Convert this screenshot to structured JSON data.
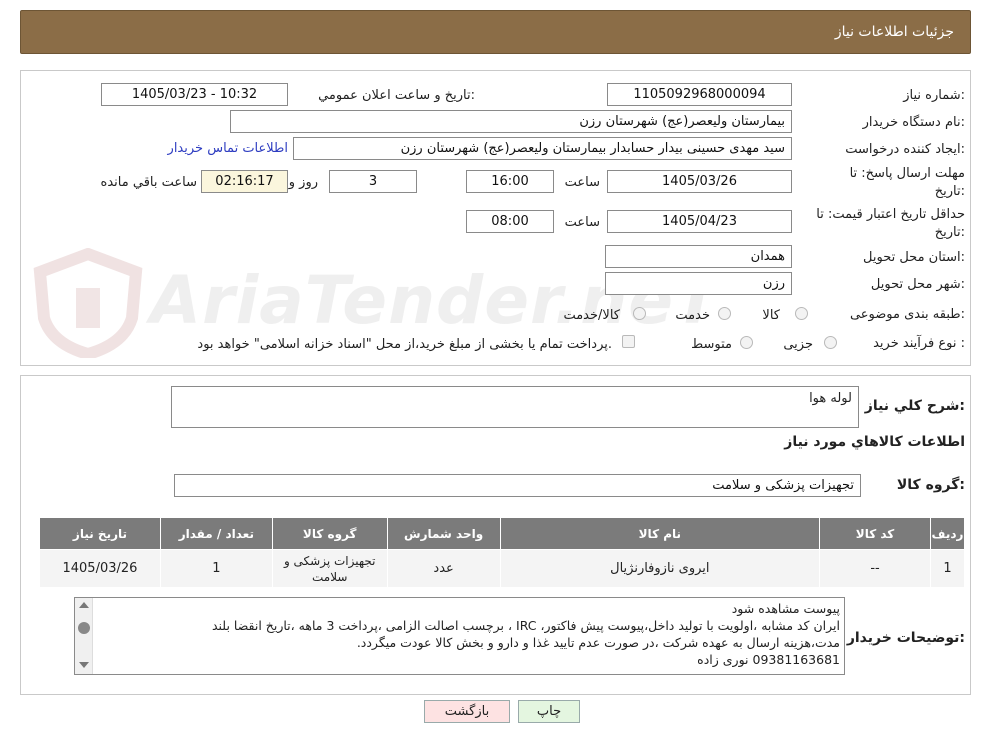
{
  "header": {
    "title": "جزئیات اطلاعات نیاز"
  },
  "watermark": "AriaTender.neT",
  "form": {
    "need_number_label": "شماره نیاز:",
    "need_number": "1105092968000094",
    "announce_label": "تاریخ و ساعت اعلان عمومي:",
    "announce_value": "1405/03/23 - 10:32",
    "buyer_org_label": "نام دستگاه خریدار:",
    "buyer_org": "بیمارستان ولیعصر(عج) شهرستان رزن",
    "creator_label": "ایجاد کننده درخواست:",
    "creator": "سید مهدی حسینی بیدار حسابدار بیمارستان ولیعصر(عج) شهرستان رزن",
    "contact_link": "اطلاعات تماس خریدار",
    "deadline_label1": "مهلت ارسال پاسخ: تا",
    "deadline_label2": "تاریخ:",
    "deadline_date": "1405/03/26",
    "time_label": "ساعت",
    "deadline_time": "16:00",
    "days_value": "3",
    "days_label": "روز و",
    "remaining_time": "02:16:17",
    "remaining_label": "ساعت باقي مانده",
    "validity_label1": "حداقل تاریخ اعتبار قیمت: تا",
    "validity_label2": "تاریخ:",
    "validity_date": "1405/04/23",
    "validity_time_label": "ساعت",
    "validity_time": "08:00",
    "province_label": "استان محل تحویل:",
    "province": "همدان",
    "city_label": "شهر محل تحویل:",
    "city": "رزن",
    "category_label": "طبقه بندی موضوعی:",
    "category_options": [
      "کالا",
      "خدمت",
      "کالا/خدمت"
    ],
    "process_label": "نوع فرآیند خرید :",
    "process_options": [
      "جزیی",
      "متوسط"
    ],
    "payment_note": "پرداخت تمام یا بخشی از مبلغ خرید،از محل \"اسناد خزانه اسلامی\" خواهد بود."
  },
  "details": {
    "desc_label": "شرح کلي نياز:",
    "desc_value": "لوله هوا",
    "goods_info_title": "اطلاعات کالاهاي مورد نياز",
    "goods_group_label": "گروه کالا:",
    "goods_group_value": "تجهیزات پزشکی و سلامت"
  },
  "table": {
    "headers": [
      "ردیف",
      "کد کالا",
      "نام کالا",
      "واحد شمارش",
      "گروه کالا",
      "تعداد / مقدار",
      "تاریخ نیاز"
    ],
    "rows": [
      [
        "1",
        "--",
        "ایروی نازوفارنژیال",
        "عدد",
        "تجهیزات پزشکی و سلامت",
        "1",
        "1405/03/26"
      ]
    ]
  },
  "buyer_notes": {
    "label": "توضیحات خریدار:",
    "lines": [
      "پیوست مشاهده شود",
      "ایران کد مشابه ،اولویت با تولید داخل،پیوست پیش فاکتور، IRC ، برچسب اصالت الزامی ،پرداخت 3 ماهه ،تاریخ انقضا بلند",
      "مدت،هزینه ارسال به عهده شرکت ،در صورت عدم تایید غذا و دارو و بخش کالا عودت میگردد.",
      "09381163681 نوری زاده"
    ]
  },
  "buttons": {
    "print": "چاپ",
    "back": "بازگشت"
  },
  "colors": {
    "header_bg": "#8b6d47",
    "table_header_bg": "#7b7b7b",
    "link": "#2e3dc1",
    "back_button_bg": "#fde2e2",
    "print_button_bg": "#e4f6e0"
  }
}
